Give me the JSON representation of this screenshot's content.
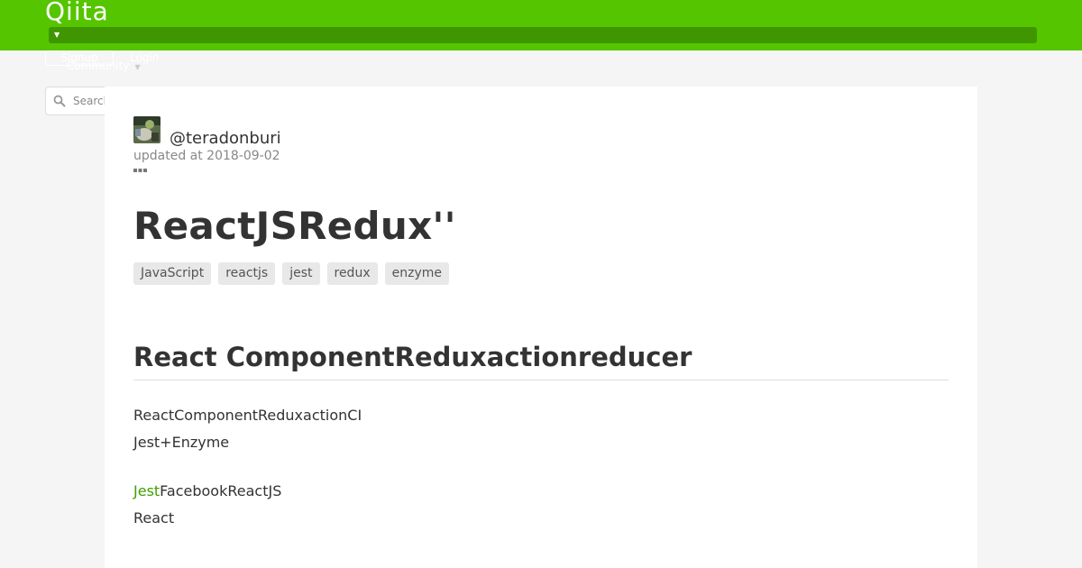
{
  "header": {
    "logo": "Qiita",
    "signup_label": "Signup",
    "login_label": "Login",
    "community_label": "Community",
    "bar_caret": "▼",
    "community_caret": "▼"
  },
  "search": {
    "placeholder": "Search"
  },
  "article": {
    "username": "@teradonburi",
    "updated": "updated at 2018-09-02",
    "title": "ReactJSRedux''",
    "tags": [
      "JavaScript",
      "reactjs",
      "jest",
      "redux",
      "enzyme"
    ],
    "h2": "React ComponentReduxactionreducer",
    "p1_lines": [
      "ReactComponentReduxactionCI",
      "Jest+Enzyme"
    ],
    "p2_link": "Jest",
    "p2_line1_rest": "FacebookReactJS",
    "p2_line2": "React"
  },
  "colors": {
    "brand": "#55c500",
    "brand_dark": "#3f9600",
    "link": "#3f9f00"
  }
}
